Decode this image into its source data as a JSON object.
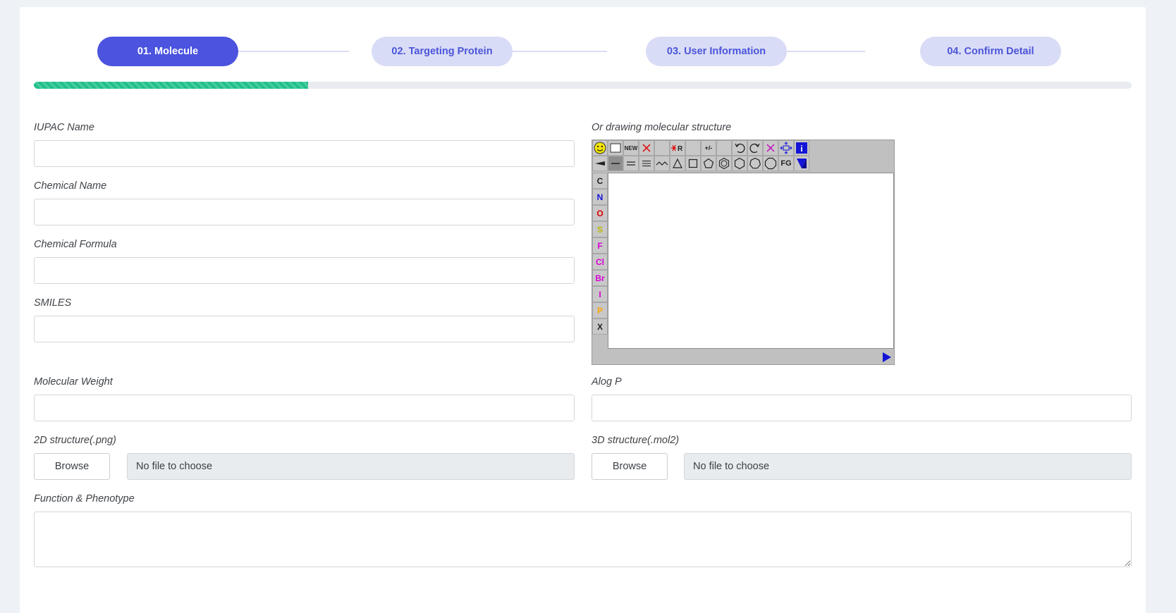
{
  "steps": [
    {
      "label": "01. Molecule",
      "active": true
    },
    {
      "label": "02. Targeting Protein",
      "active": false
    },
    {
      "label": "03. User Information",
      "active": false
    },
    {
      "label": "04. Confirm Detail",
      "active": false
    }
  ],
  "progress": {
    "fraction": 0.25
  },
  "colors": {
    "primary": "#4b53df",
    "step_inactive": "#d9dcf6",
    "progress": "#1fbf8a"
  },
  "form": {
    "iupac_name": {
      "label": "IUPAC Name",
      "value": ""
    },
    "chemical_name": {
      "label": "Chemical Name",
      "value": ""
    },
    "chemical_formula": {
      "label": "Chemical Formula",
      "value": ""
    },
    "smiles": {
      "label": "SMILES",
      "value": ""
    },
    "drawing_label": "Or drawing molecular structure",
    "molecular_weight": {
      "label": "Molecular Weight",
      "value": ""
    },
    "alog_p": {
      "label": "Alog P",
      "value": ""
    },
    "structure_2d": {
      "label": "2D structure(.png)",
      "button": "Browse",
      "file_text": "No file to choose"
    },
    "structure_3d": {
      "label": "3D structure(.mol2)",
      "button": "Browse",
      "file_text": "No file to choose"
    },
    "function_phenotype": {
      "label": "Function & Phenotype",
      "value": ""
    }
  },
  "editor": {
    "toolbar_top": [
      "smiley-icon",
      "blank-icon",
      "NEW",
      "delete-x-icon",
      "",
      "delete-r-icon",
      "",
      "charge-icon",
      "",
      "undo-icon",
      "redo-icon",
      "clear-icon",
      "move-icon",
      "info-icon"
    ],
    "new_label": "NEW",
    "r_label": "R",
    "fg_label": "FG",
    "info_label": "i",
    "charge_label": "+/-",
    "atoms": [
      {
        "symbol": "C",
        "color": "#222222"
      },
      {
        "symbol": "N",
        "color": "#1414d8"
      },
      {
        "symbol": "O",
        "color": "#e00000"
      },
      {
        "symbol": "S",
        "color": "#b8b800"
      },
      {
        "symbol": "F",
        "color": "#d800d8"
      },
      {
        "symbol": "Cl",
        "color": "#d800d8"
      },
      {
        "symbol": "Br",
        "color": "#d800d8"
      },
      {
        "symbol": "I",
        "color": "#d800d8"
      },
      {
        "symbol": "P",
        "color": "#ffa500"
      },
      {
        "symbol": "X",
        "color": "#222222"
      }
    ]
  }
}
